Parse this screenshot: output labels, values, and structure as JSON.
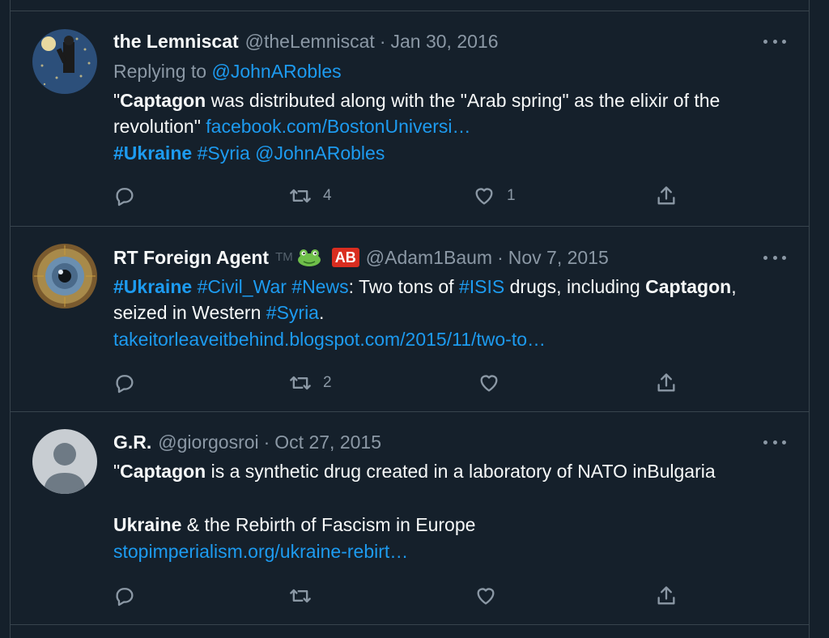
{
  "tweets": [
    {
      "display_name": "the Lemniscat",
      "handle": "@theLemniscat",
      "separator": "·",
      "date": "Jan 30, 2016",
      "replying_prefix": "Replying to ",
      "replying_to": "@JohnARobles",
      "text": {
        "l1_a": "\"",
        "l1_b": "Captagon",
        "l1_c": " was distributed along with the \"Arab spring\" as the elixir of the",
        "l2_a": "revolution\" ",
        "l2_link": "facebook.com/BostonUniversi…",
        "l3_tag1": "#Ukraine",
        "l3_tag2": "#Syria",
        "l3_mention": "@JohnARobles"
      },
      "actions": {
        "reply": "",
        "retweet": "4",
        "like": "1"
      }
    },
    {
      "display_name": "RT Foreign Agent",
      "badge_tm": "TM",
      "badge_ab": "AB",
      "handle": "@Adam1Baum",
      "separator": "·",
      "date": "Nov 7, 2015",
      "text": {
        "l1_tag1": "#Ukraine",
        "l1_tag2": "#Civil_War",
        "l1_tag3": "#News",
        "l1_a": ": Two tons of ",
        "l1_tag4": "#ISIS",
        "l1_b": " drugs, including ",
        "l1_c": "Captagon",
        "l1_d": ",",
        "l2_a": "seized in Western ",
        "l2_tag": "#Syria",
        "l2_b": ".",
        "l3_link": "takeitorleaveitbehind.blogspot.com/2015/11/two-to…"
      },
      "actions": {
        "reply": "",
        "retweet": "2",
        "like": ""
      }
    },
    {
      "display_name": "G.R.",
      "handle": "@giorgosroi",
      "separator": "·",
      "date": "Oct 27, 2015",
      "text": {
        "l1_a": "\"",
        "l1_b": "Captagon",
        "l1_c": " is a synthetic drug created in a laboratory of NATO inBulgaria",
        "l3_a": "Ukraine",
        "l3_b": " & the Rebirth of Fascism in Europe",
        "l4_link": "stopimperialism.org/ukraine-rebirt…"
      },
      "actions": {
        "reply": "",
        "retweet": "",
        "like": ""
      }
    }
  ],
  "icons": {
    "reply": "reply-icon",
    "retweet": "retweet-icon",
    "like": "heart-icon",
    "share": "share-icon",
    "more": "more-icon"
  },
  "colors": {
    "background": "#15202b",
    "border": "#38444d",
    "text": "#f7f9f9",
    "muted": "#8b98a5",
    "link": "#1d9bf0"
  }
}
